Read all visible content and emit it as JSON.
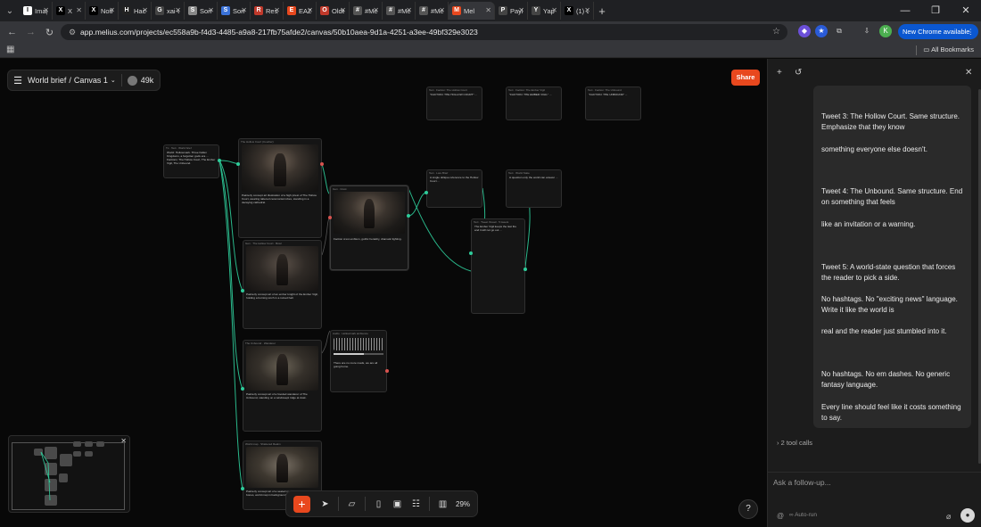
{
  "browser": {
    "tabs": [
      {
        "label": "Imag",
        "fav": "I",
        "color": "#ffffff"
      },
      {
        "label": "X",
        "fav": "X",
        "color": "#000000"
      },
      {
        "label": "Notif",
        "fav": "X",
        "color": "#000000"
      },
      {
        "label": "Hack",
        "fav": "H",
        "color": "#222222"
      },
      {
        "label": "xai-o",
        "fav": "G",
        "color": "#444444"
      },
      {
        "label": "Som",
        "fav": "S",
        "color": "#888888"
      },
      {
        "label": "Som",
        "fav": "S",
        "color": "#3b73d9"
      },
      {
        "label": "Resp",
        "fav": "R",
        "color": "#c0392b"
      },
      {
        "label": "EAZC",
        "fav": "E",
        "color": "#e8481e"
      },
      {
        "label": "Olde",
        "fav": "O",
        "color": "#c0392b"
      },
      {
        "label": "#Mel",
        "fav": "#",
        "color": "#555555"
      },
      {
        "label": "#Mel",
        "fav": "#",
        "color": "#555555"
      },
      {
        "label": "#Mel",
        "fav": "#",
        "color": "#555555"
      },
      {
        "label": "Mel",
        "fav": "M",
        "color": "#e8481e"
      },
      {
        "label": "Payl",
        "fav": "P",
        "color": "#444444"
      },
      {
        "label": "Yap",
        "fav": "Y",
        "color": "#444444"
      },
      {
        "label": "(1) C",
        "fav": "X",
        "color": "#000000"
      }
    ],
    "url": "app.melius.com/projects/ec558a9b-f4d3-4485-a9a8-217fb75afde2/canvas/50b10aea-9d1a-4251-a3ee-49bf329e3023",
    "update_label": "New Chrome available",
    "all_bookmarks": "All Bookmarks",
    "profile_initial": "K"
  },
  "canvas": {
    "crumb_project": "World brief",
    "crumb_separator": "/",
    "crumb_canvas": "Canvas 1",
    "credits": "49k",
    "share_label": "Share",
    "zoom": "29%",
    "help": "?"
  },
  "nodes": [
    {
      "id": "n1",
      "head": "Tx · Text · World brief",
      "text": "World: Hollowmark. Three Fallen Kingdoms, a forgotten gods era ... Factions: The Hollow Court, The Ember Vigil, The Unbound."
    },
    {
      "id": "n2",
      "head": "The Hollow Court (Courtier)",
      "text": "Painterly concept art illustration of a high priest of The Hollow Court, wearing tattered ceremonial robes, standing in a decaying cathedral."
    },
    {
      "id": "n3",
      "head": "Gen · The Hollow Court · Bowl",
      "text": "Painterly concept art of an ember knight of the Ember Vigil, holding a burning torch in a ruined hall."
    },
    {
      "id": "n4",
      "head": "The Unbound · Wanderer",
      "text": "Painterly concept art of a hooded wanderer of The Unbound, standing on a windswept ridge at dusk."
    },
    {
      "id": "n5",
      "head": "World map · Shattered Realm",
      "text": "Painterly concept art of a seated monarch on a throne of bones, world map in background."
    },
    {
      "id": "n6",
      "head": "Gen · Crest",
      "text": "Faction crest emblem, gothic heraldry, dramatic lighting."
    },
    {
      "id": "n7",
      "head": "Audio · Hollowmark ambience",
      "text": "There are no more roads, we are all going home."
    },
    {
      "id": "n8",
      "head": "Text · Faction: The Hollow Court",
      "text": "\"FACTION: THE HOLLOW COURT\" ..."
    },
    {
      "id": "n9",
      "head": "Text · Faction: The Ember Vigil",
      "text": "\"FACTION: THE EMBER VIGIL\" ..."
    },
    {
      "id": "n10",
      "head": "Text · Faction: The Unbound",
      "text": "\"FACTION: THE UNBOUND\" ..."
    },
    {
      "id": "n11",
      "head": "Text · Lore Brief",
      "text": "A single oblique reference to the Hollow Court ..."
    },
    {
      "id": "n12",
      "head": "Text · World State",
      "text": "A question only the world can answer ..."
    },
    {
      "id": "n13",
      "head": "Text · Tweet thread · 5 tweets",
      "text": "The Ember Vigil keeps the last fire and it will not go out ..."
    }
  ],
  "chat": {
    "paragraphs": [
      "Tweet 3: The Hollow Court. Same structure. Emphasize that they know",
      "something everyone else doesn't.",
      "Tweet 4: The Unbound. Same structure. End on something that feels",
      "like an invitation or a warning.",
      "Tweet 5: A world-state question that forces the reader to pick a side.",
      "No hashtags. No \"exciting news\" language. Write it like the world is",
      "real and the reader just stumbled into it.",
      "No hashtags. No em dashes. No generic fantasy language.",
      "Every line should feel like it costs something to say."
    ],
    "tool_calls": "2 tool calls",
    "placeholder": "Ask a follow-up...",
    "auto_run": "Auto-run"
  },
  "colors": {
    "accent": "#e8481e",
    "port_green": "#2ecc9a",
    "port_red": "#d9534f",
    "chrome_blue": "#0b57d0"
  },
  "icons": {
    "menu": "hamburger-icon",
    "add": "plus-icon",
    "history": "history-icon",
    "close": "close-icon",
    "mic": "mic-icon",
    "attach": "paperclip-icon"
  }
}
